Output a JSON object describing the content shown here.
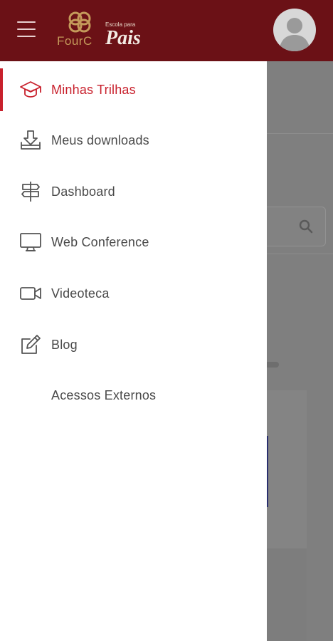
{
  "header": {
    "menu_icon": "hamburger-icon",
    "logo": {
      "brand": "FourC",
      "small_text": "Escola para",
      "script_text": "Pais"
    },
    "avatar_icon": "user-avatar-icon"
  },
  "drawer": {
    "items": [
      {
        "label": "Minhas Trilhas",
        "icon": "graduation-cap-icon",
        "active": true
      },
      {
        "label": "Meus downloads",
        "icon": "download-tray-icon",
        "active": false
      },
      {
        "label": "Dashboard",
        "icon": "signpost-icon",
        "active": false
      },
      {
        "label": "Web Conference",
        "icon": "monitor-icon",
        "active": false
      },
      {
        "label": "Videoteca",
        "icon": "video-camera-icon",
        "active": false
      },
      {
        "label": "Blog",
        "icon": "edit-icon",
        "active": false
      },
      {
        "label": "Acessos Externos",
        "icon": "",
        "active": false
      }
    ]
  },
  "colors": {
    "header_bg": "#6b1116",
    "accent": "#c8202c",
    "overlay": "#7a7a7a"
  }
}
